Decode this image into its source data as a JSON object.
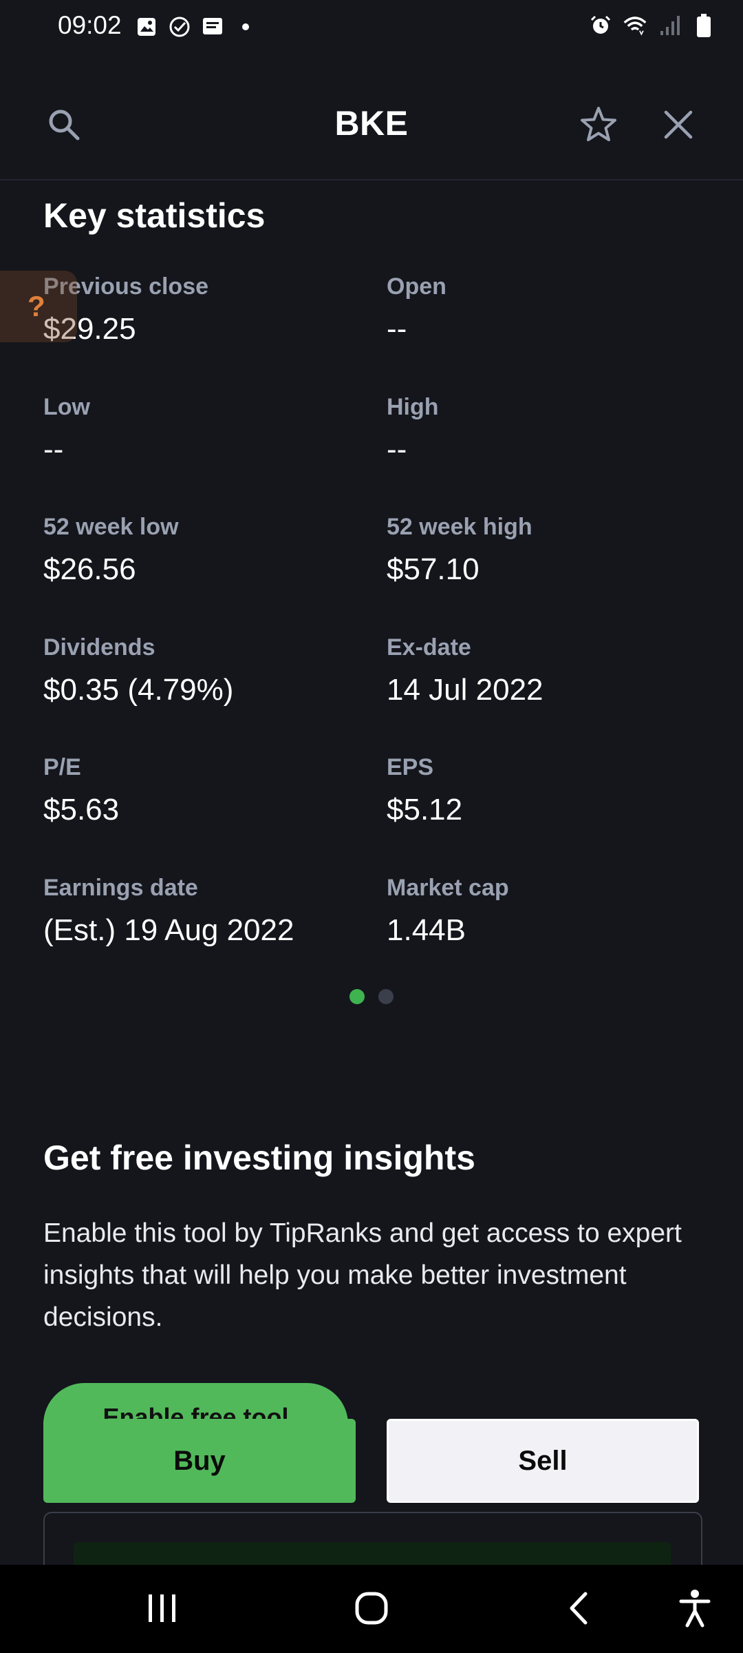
{
  "status_bar": {
    "time": "09:02",
    "left_icons": [
      "gallery-icon",
      "check-circle-icon",
      "message-icon",
      "dot-icon"
    ],
    "right_icons": [
      "alarm-icon",
      "wifi-icon",
      "signal-icon",
      "battery-icon"
    ]
  },
  "header": {
    "title": "BKE",
    "search_icon": "search-icon",
    "star_icon": "star-icon",
    "close_icon": "close-icon"
  },
  "key_statistics": {
    "title": "Key statistics",
    "stats": [
      {
        "label": "Previous close",
        "value": "$29.25"
      },
      {
        "label": "Open",
        "value": "--"
      },
      {
        "label": "Low",
        "value": "--"
      },
      {
        "label": "High",
        "value": "--"
      },
      {
        "label": "52 week low",
        "value": "$26.56"
      },
      {
        "label": "52 week high",
        "value": "$57.10"
      },
      {
        "label": "Dividends",
        "value": "$0.35 (4.79%)"
      },
      {
        "label": "Ex-date",
        "value": "14 Jul 2022"
      },
      {
        "label": "P/E",
        "value": "$5.63"
      },
      {
        "label": "EPS",
        "value": "$5.12"
      },
      {
        "label": "Earnings date",
        "value": "(Est.) 19 Aug 2022"
      },
      {
        "label": "Market cap",
        "value": "1.44B"
      }
    ]
  },
  "help_tab": {
    "label": "?"
  },
  "pager": {
    "count": 2,
    "active": 1
  },
  "insights": {
    "title": "Get free investing insights",
    "body": "Enable this tool by TipRanks and get access to expert insights that will help you make better investment decisions.",
    "enable_label": "Enable free tool"
  },
  "trade": {
    "buy_label": "Buy",
    "sell_label": "Sell"
  },
  "colors": {
    "background": "#14161c",
    "accent_green": "#52b95a",
    "label_gray": "#9aa1b1"
  }
}
